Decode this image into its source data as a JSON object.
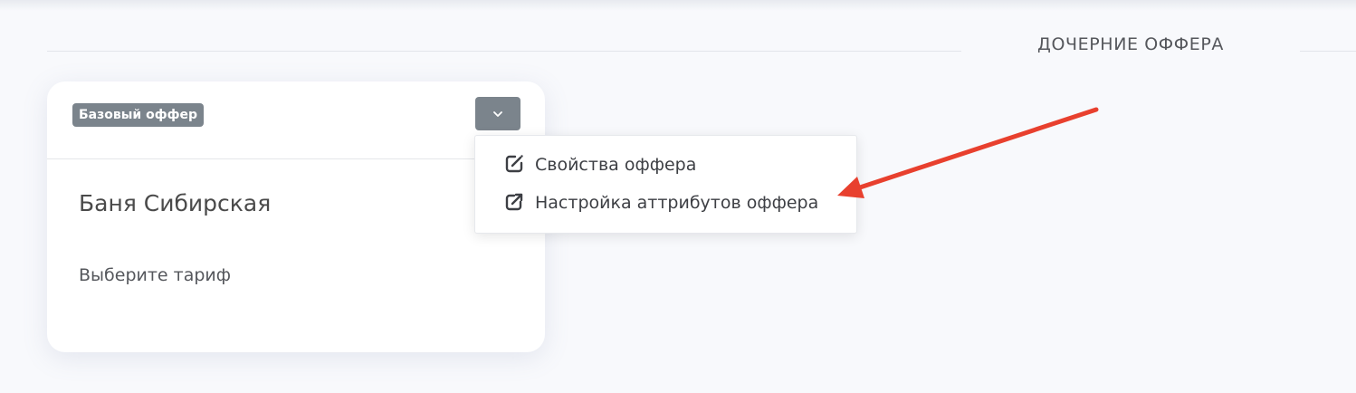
{
  "section": {
    "title": "ДОЧЕРНИЕ ОФФЕРА"
  },
  "card": {
    "badge": "Базовый оффер",
    "title": "Баня Сибирская",
    "subtitle": "Выберите тариф"
  },
  "menu": {
    "items": [
      {
        "label": "Свойства оффера",
        "icon": "edit-icon"
      },
      {
        "label": "Настройка аттрибутов оффера",
        "icon": "external-link-icon"
      }
    ]
  },
  "colors": {
    "badge_bg": "#7b848c",
    "annotation_arrow": "#e8402e"
  }
}
